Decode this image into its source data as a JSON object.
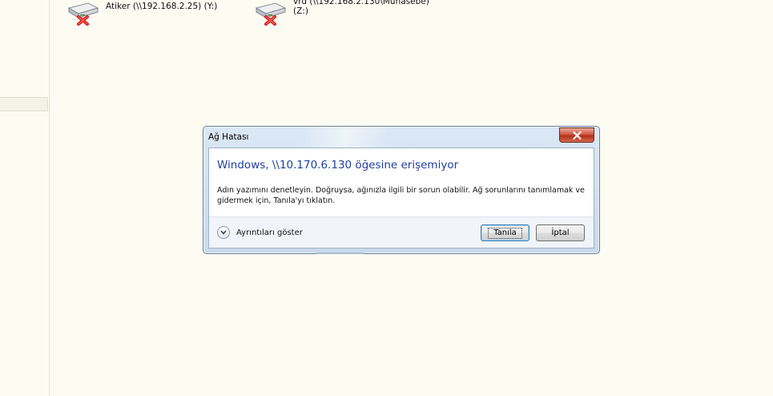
{
  "drives": [
    {
      "label_line1": "Atiker (\\\\192.168.2.25) (Y:)",
      "label_line2": ""
    },
    {
      "label_line1": "vrd (\\\\192.168.2.130\\Muhasebe)",
      "label_line2": "(Z:)"
    }
  ],
  "dialog": {
    "title": "Ağ Hatası",
    "heading": "Windows, \\\\10.170.6.130 öğesine erişemiyor",
    "description": "Adın yazımını denetleyin. Doğruysa, ağınızla ilgili bir sorun olabilir. Ağ sorunlarını tanımlamak ve gidermek için, Tanıla'yı tıklatın.",
    "details_label": "Ayrıntıları göster",
    "diagnose_button": "Tanıla",
    "cancel_button": "İptal",
    "close_icon": "close-icon",
    "expand_icon": "chevron-down-icon"
  },
  "colors": {
    "background": "#fdfcf3",
    "heading": "#1e3f9e",
    "close_button": "#c8452c"
  }
}
